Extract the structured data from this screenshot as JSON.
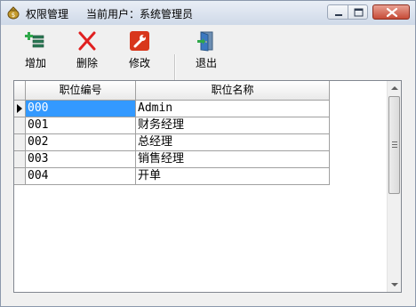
{
  "window": {
    "title": "权限管理",
    "user_label": "当前用户：系统管理员",
    "app_icon": "money-bag-icon",
    "controls": [
      "minimize-icon",
      "maximize-icon",
      "close-icon"
    ]
  },
  "toolbar": {
    "add_label": "增加",
    "delete_label": "删除",
    "edit_label": "修改",
    "exit_label": "退出",
    "icons": {
      "add": "add-record-icon",
      "delete": "red-x-icon",
      "edit": "wrench-icon",
      "exit": "door-exit-icon"
    }
  },
  "grid": {
    "columns": [
      "职位编号",
      "职位名称"
    ],
    "rows": [
      {
        "code": "000",
        "name": "Admin"
      },
      {
        "code": "001",
        "name": "财务经理"
      },
      {
        "code": "002",
        "name": "总经理"
      },
      {
        "code": "003",
        "name": "销售经理"
      },
      {
        "code": "004",
        "name": "开单"
      }
    ],
    "selected_row": 0
  },
  "colors": {
    "selection": "#3399ff",
    "close_button": "#c64b37",
    "delete_icon": "#e02020",
    "edit_icon": "#d8371c"
  }
}
